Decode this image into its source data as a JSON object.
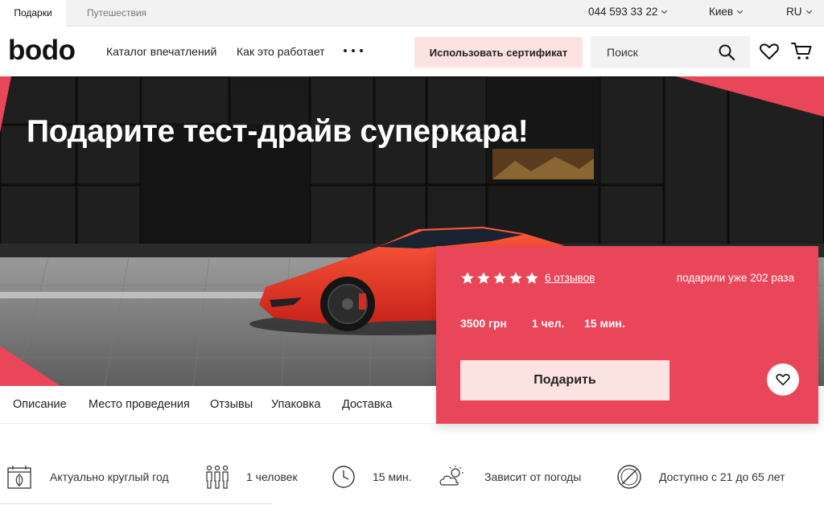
{
  "topbar": {
    "tabs": [
      {
        "label": "Подарки"
      },
      {
        "label": "Путешествия"
      }
    ],
    "phone": "044 593 33 22",
    "city": "Киев",
    "lang": "RU"
  },
  "header": {
    "logo": "bodo",
    "nav": [
      {
        "label": "Каталог впечатлений"
      },
      {
        "label": "Как это работает"
      }
    ],
    "cert_button": "Использовать сертификат",
    "search_placeholder": "Поиск"
  },
  "hero": {
    "title": "Подарите тест-драйв суперкара!"
  },
  "card": {
    "rating": 5,
    "reviews": "6 отзывов",
    "gifted": "подарили уже 202 раза",
    "price": "3500 грн",
    "people": "1 чел.",
    "duration": "15 мин.",
    "gift_button": "Подарить"
  },
  "tabs": [
    {
      "label": "Описание"
    },
    {
      "label": "Место проведения"
    },
    {
      "label": "Отзывы"
    },
    {
      "label": "Упаковка"
    },
    {
      "label": "Доставка"
    }
  ],
  "features": [
    {
      "label": "Актуально круглый год",
      "icon": "calendar-leaf-icon"
    },
    {
      "label": "1 человек",
      "icon": "people-icon"
    },
    {
      "label": "15 мин.",
      "icon": "clock-icon"
    },
    {
      "label": "Зависит от погоды",
      "icon": "weather-icon"
    },
    {
      "label": "Доступно с 21 до 65 лет",
      "icon": "age-restriction-icon"
    }
  ],
  "colors": {
    "accent": "#ea4659",
    "button_light": "#fde2e2",
    "topbar_bg": "#f2f2f2"
  }
}
